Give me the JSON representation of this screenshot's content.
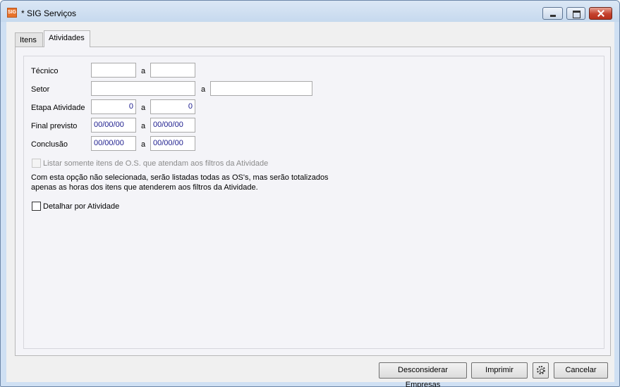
{
  "window": {
    "title": "* SIG Serviços",
    "icon": "sig-app-icon"
  },
  "tabs": [
    {
      "label": "Itens",
      "active": false
    },
    {
      "label": "Atividades",
      "active": true
    }
  ],
  "form": {
    "tecnico": {
      "label": "Técnico",
      "from": "",
      "to": ""
    },
    "setor": {
      "label": "Setor",
      "from": "",
      "to": ""
    },
    "etapa": {
      "label": "Etapa Atividade",
      "from": "0",
      "to": "0"
    },
    "final_previsto": {
      "label": "Final previsto",
      "from": "00/00/00",
      "to": "00/00/00"
    },
    "conclusao": {
      "label": "Conclusão",
      "from": "00/00/00",
      "to": "00/00/00"
    },
    "range_separator": "a",
    "listar_checkbox": {
      "label": "Listar somente itens de O.S. que atendam aos filtros da Atividade",
      "checked": false,
      "enabled": false
    },
    "info_line1": "Com esta opção não selecionada, serão listadas todas as OS's, mas serão totalizados",
    "info_line2": "apenas as horas dos itens que atenderem aos filtros da Atividade.",
    "detalhar_checkbox": {
      "label": "Detalhar por Atividade",
      "checked": false,
      "enabled": true
    }
  },
  "buttons": {
    "desconsiderar": "Desconsiderar Empresas",
    "imprimir": "Imprimir",
    "settings_icon": "gear-icon",
    "cancelar": "Cancelar"
  },
  "colors": {
    "titlebar": "#c6d9ee",
    "close_button": "#c4412d",
    "date_text": "#1a1a8c"
  }
}
